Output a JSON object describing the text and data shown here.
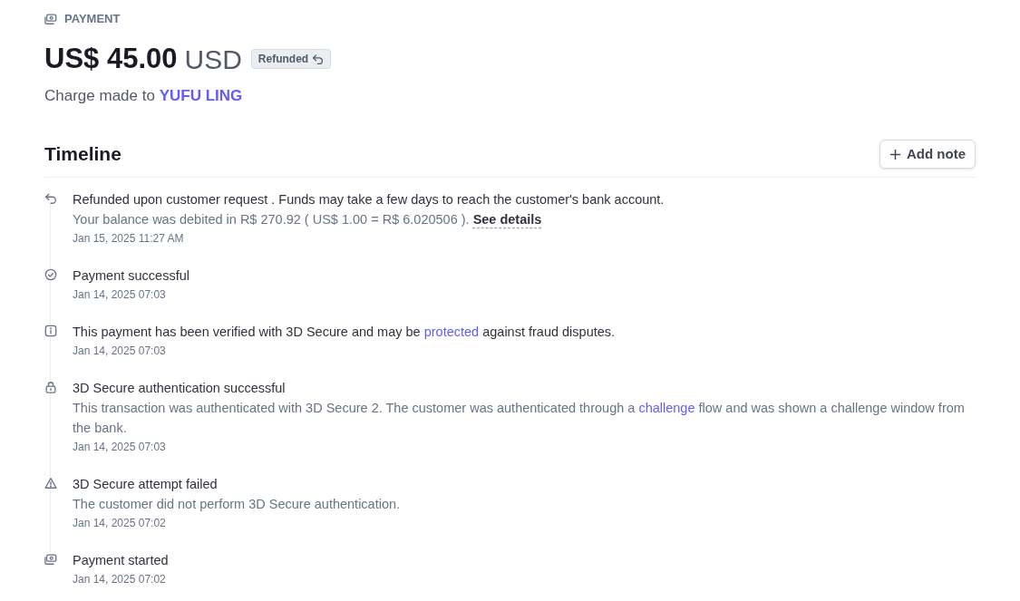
{
  "header": {
    "eyebrow": "PAYMENT",
    "amount": "US$ 45.00",
    "currency": "USD",
    "status": {
      "label": "Refunded",
      "kind": "refunded"
    },
    "charge_prefix": "Charge made to",
    "customer": "YUFU LING"
  },
  "timeline": {
    "title": "Timeline",
    "add_note": "Add note",
    "events": [
      {
        "kind": "refund",
        "title": [
          {
            "kind": "text",
            "text": "Refunded upon customer request . Funds may take a few days to reach the customer's bank account."
          }
        ],
        "description": [
          {
            "kind": "text",
            "text": "Your balance was debited in R$ 270.92 ( US$ 1.00 = R$ 6.020506 ). "
          },
          {
            "kind": "details",
            "text": "See details"
          }
        ],
        "time": "Jan 15, 2025 11:27 AM"
      },
      {
        "kind": "success",
        "title": [
          {
            "kind": "text",
            "text": "Payment successful"
          }
        ],
        "time": "Jan 14, 2025 07:03"
      },
      {
        "kind": "verification",
        "title": [
          {
            "kind": "text",
            "text": "This payment has been verified with 3D Secure and may be "
          },
          {
            "kind": "link",
            "text": "protected"
          },
          {
            "kind": "text",
            "text": " against fraud disputes."
          }
        ],
        "time": "Jan 14, 2025 07:03"
      },
      {
        "kind": "authentication",
        "title": [
          {
            "kind": "text",
            "text": "3D Secure authentication successful"
          }
        ],
        "description": [
          {
            "kind": "text",
            "text": "This transaction was authenticated with 3D Secure 2. The customer was authenticated through a "
          },
          {
            "kind": "link",
            "text": "challenge"
          },
          {
            "kind": "text",
            "text": " flow and was shown a challenge window from the bank."
          }
        ],
        "time": "Jan 14, 2025 07:03"
      },
      {
        "kind": "failure",
        "title": [
          {
            "kind": "text",
            "text": "3D Secure attempt failed"
          }
        ],
        "description": [
          {
            "kind": "text",
            "text": "The customer did not perform 3D Secure authentication."
          }
        ],
        "time": "Jan 14, 2025 07:02"
      },
      {
        "kind": "start",
        "title": [
          {
            "kind": "text",
            "text": "Payment started"
          }
        ],
        "time": "Jan 14, 2025 07:02"
      }
    ]
  }
}
